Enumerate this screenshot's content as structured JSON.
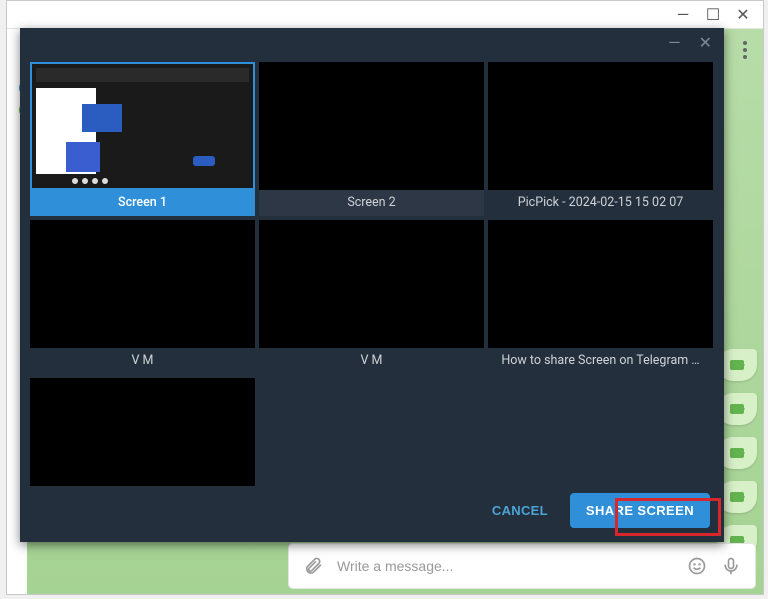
{
  "outer_window": {
    "minimize_glyph": "—",
    "maximize_glyph": "☐",
    "close_glyph": "✕"
  },
  "modal_window": {
    "minimize_glyph": "—",
    "close_glyph": "✕"
  },
  "tiles": [
    {
      "label": "Screen 1",
      "selected": true,
      "bare_caption": false,
      "kind": "preview"
    },
    {
      "label": "Screen 2",
      "selected": false,
      "bare_caption": false,
      "kind": "black"
    },
    {
      "label": "PicPick - 2024-02-15 15 02 07",
      "selected": false,
      "bare_caption": true,
      "kind": "black"
    },
    {
      "label": "V M",
      "selected": false,
      "bare_caption": true,
      "kind": "black"
    },
    {
      "label": "V M",
      "selected": false,
      "bare_caption": true,
      "kind": "black"
    },
    {
      "label": "How to share Screen on Telegram …",
      "selected": false,
      "bare_caption": true,
      "kind": "black"
    },
    {
      "label": "",
      "selected": false,
      "bare_caption": true,
      "kind": "black-small"
    }
  ],
  "actions": {
    "cancel": "CANCEL",
    "share": "SHARE SCREEN"
  },
  "composer": {
    "placeholder": "Write a message..."
  },
  "colors": {
    "accent": "#2f8fd8",
    "modal_bg": "#242f3e",
    "danger_highlight": "#d8262d"
  }
}
